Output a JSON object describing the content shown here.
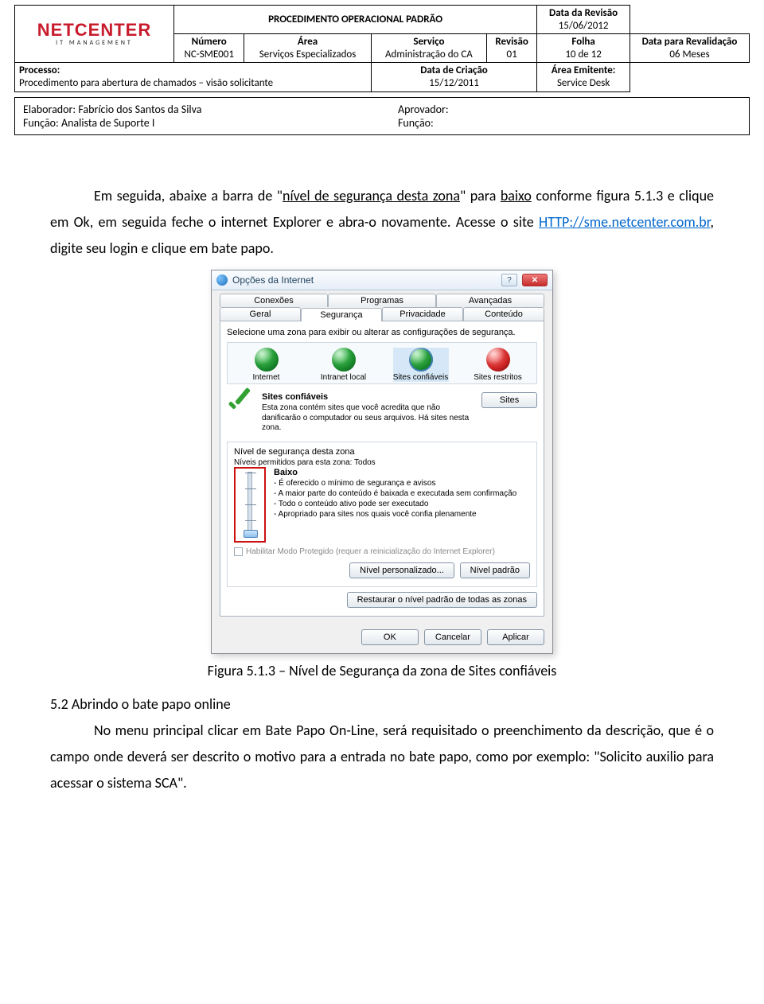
{
  "header": {
    "logo_main": "NETCENTER",
    "logo_sub": "IT MANAGEMENT",
    "doc_title": "PROCEDIMENTO OPERACIONAL PADRÃO",
    "rev_date_label": "Data da Revisão",
    "rev_date": "15/06/2012",
    "number_label": "Número",
    "number_value": "NC-SME001",
    "area_label": "Área",
    "area_value": "Serviços Especializados",
    "service_label": "Serviço",
    "service_value": "Administração do CA",
    "revision_label": "Revisão",
    "revision_value": "01",
    "page_label": "Folha",
    "page_value": "10 de 12",
    "reval_label": "Data para Revalidação",
    "reval_value": "06 Meses",
    "process_label": "Processo:",
    "process_value": "Procedimento para abertura de chamados – visão solicitante",
    "created_label": "Data de Criação",
    "created_value": "15/12/2011",
    "emit_label": "Área Emitente:",
    "emit_value": "Service Desk",
    "elaborator_label": "Elaborador:",
    "elaborator_value": "Fabrício dos Santos da Silva",
    "func_label": "Função:",
    "func_value": "Analista de Suporte I",
    "approver_label": "Aprovador:",
    "approver_value": "",
    "approver_func_label": "Função:",
    "approver_func_value": ""
  },
  "body": {
    "p1a": "Em seguida, abaixe a barra de \"",
    "p1b": "nível de segurança desta zona",
    "p1c": "\" para ",
    "p1d": "baixo",
    "p1e": " conforme figura 5.1.3 e clique em Ok, em seguida feche o internet Explorer e abra-o novamente. Acesse o site ",
    "p1link": "HTTP://sme.netcenter.com.br",
    "p1f": ", digite seu login e clique em bate papo.",
    "fig_caption": "Figura 5.1.3 – Nível de Segurança da zona de Sites confiáveis",
    "h52": "5.2 Abrindo o bate papo online",
    "p2": "No menu principal clicar em Bate Papo On-Line, será requisitado o preenchimento da descrição, que é o campo onde deverá ser descrito o motivo para a entrada no bate papo, como por exemplo: \"Solicito auxilio para acessar o sistema SCA\"."
  },
  "dialog": {
    "title": "Opções da Internet",
    "help_glyph": "?",
    "close_glyph": "✕",
    "tabs_top": [
      "Conexões",
      "Programas",
      "Avançadas"
    ],
    "tabs_bottom": [
      "Geral",
      "Segurança",
      "Privacidade",
      "Conteúdo"
    ],
    "select_zone_text": "Selecione uma zona para exibir ou alterar as configurações de segurança.",
    "zones": [
      "Internet",
      "Intranet local",
      "Sites confiáveis",
      "Sites restritos"
    ],
    "trusted_head": "Sites confiáveis",
    "trusted_body": "Esta zona contém sites que você acredita que não danificarão o computador ou seus arquivos. Há sites nesta zona.",
    "sites_btn": "Sites",
    "level_title": "Nível de segurança desta zona",
    "allowed_levels": "Níveis permitidos para esta zona: Todos",
    "level_name": "Baixo",
    "level_lines": [
      "- É oferecido o mínimo de segurança e avisos",
      "- A maior parte do conteúdo é baixada e executada sem confirmação",
      "- Todo o conteúdo ativo pode ser executado",
      "- Apropriado para sites nos quais você confia plenamente"
    ],
    "protected_mode": "Habilitar Modo Protegido (requer a reinicialização do Internet Explorer)",
    "custom_btn": "Nível personalizado...",
    "default_btn": "Nível padrão",
    "restore_btn": "Restaurar o nível padrão de todas as zonas",
    "ok": "OK",
    "cancel": "Cancelar",
    "apply": "Aplicar"
  }
}
